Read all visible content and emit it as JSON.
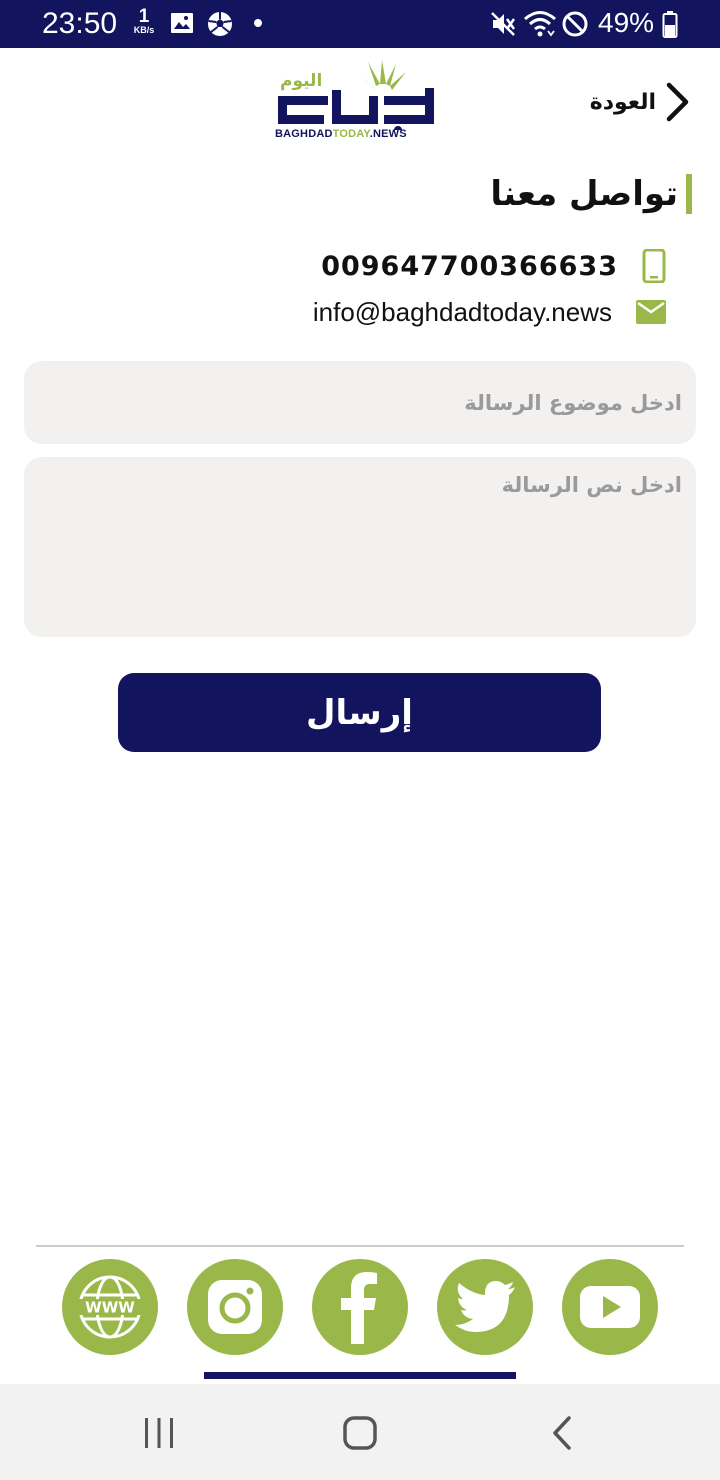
{
  "status_bar": {
    "time": "23:50",
    "net_speed_value": "1",
    "net_speed_unit": "KB/s",
    "battery_percent": "49%",
    "icons": [
      "image-icon",
      "soccer-ball-icon",
      "dot-icon",
      "mute-icon",
      "wifi-icon",
      "do-not-disturb-icon",
      "battery-icon"
    ]
  },
  "header": {
    "back_label": "العودة",
    "logo_text_arabic": "بغداد اليوم",
    "logo_subtitle_part1": "BAGHDAD",
    "logo_subtitle_part2": "TODAY",
    "logo_subtitle_part3": ".NEWS"
  },
  "page": {
    "title": "تواصل معنا"
  },
  "contact": {
    "phone": "009647700366633",
    "email": "info@baghdadtoday.news"
  },
  "form": {
    "subject_placeholder": "ادخل موضوع الرسالة",
    "body_placeholder": "ادخل نص الرسالة",
    "send_label": "إرسال"
  },
  "social": {
    "items": [
      "website-icon",
      "instagram-icon",
      "facebook-icon",
      "twitter-icon",
      "youtube-icon"
    ],
    "website_label": "WWW"
  },
  "colors": {
    "navy": "#12145e",
    "green": "#9ab84a",
    "input_bg": "#f3f1f0"
  }
}
